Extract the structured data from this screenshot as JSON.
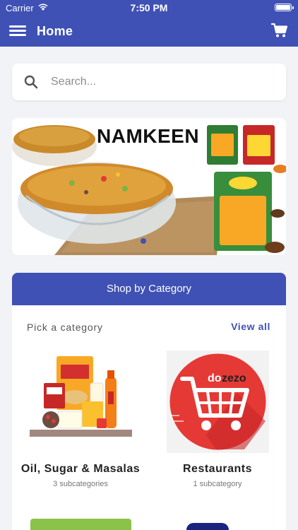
{
  "status_bar": {
    "carrier": "Carrier",
    "time": "7:50 PM"
  },
  "app_bar": {
    "title": "Home",
    "menu_icon": "hamburger-menu-icon",
    "cart_icon": "shopping-cart-icon"
  },
  "search": {
    "placeholder": "Search...",
    "value": ""
  },
  "banner": {
    "title": "NAMKEEN",
    "slides_indicator": "1"
  },
  "category_section": {
    "header": "Shop by Category",
    "pick_label": "Pick a category",
    "view_all": "View all",
    "categories": [
      {
        "name": "Oil, Sugar & Masalas",
        "subcategories": "3 subcategories"
      },
      {
        "name": "Restaurants",
        "subcategories": "1 subcategory"
      }
    ]
  },
  "colors": {
    "primary": "#3f51b5",
    "background": "#f2f3f7",
    "card": "#ffffff",
    "restaurant_red": "#e53935"
  }
}
